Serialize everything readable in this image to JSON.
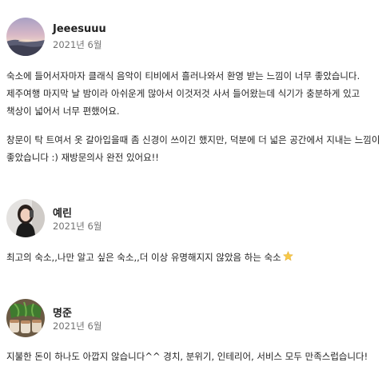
{
  "reviews": [
    {
      "name": "Jeeesuuu",
      "date": "2021년 6월",
      "paragraphs": [
        "숙소에 들어서자마자 클래식 음악이 티비에서 흘러나와서 환영 받는 느낌이 너무 좋았습니다. 제주여행 마지막 날 밤이라 아쉬운게 많아서 이것저것 사서 들어왔는데 식기가 충분하게 있고 책상이 넓어서 너무 편했어요.",
        "창문이 탁 트여서 옷 갈아입을때 좀 신경이 쓰이긴 했지만, 덕분에 더 넓은 공간에서 지내는 느낌이 좋았습니다 :) 재방문의사 완전 있어요!!"
      ],
      "avatar_icon": "sunset-landscape-photo"
    },
    {
      "name": "예린",
      "date": "2021년 6월",
      "paragraphs": [
        "최고의 숙소,,나만 알고 싶은 숙소,,더 이상 유명해지지 않았음 하는 숙소"
      ],
      "avatar_icon": "person-selfie-photo",
      "trailing_emoji": "star-icon"
    },
    {
      "name": "명준",
      "date": "2021년 6월",
      "paragraphs": [
        "지불한 돈이 하나도 아깝지 않습니다^^ 경치, 분위기, 인테리어, 서비스 모두 만족스럽습니다!"
      ],
      "avatar_icon": "food-dish-photo"
    }
  ],
  "colors": {
    "text": "#222222",
    "secondary_text": "#717171",
    "star": "#f7c948"
  }
}
